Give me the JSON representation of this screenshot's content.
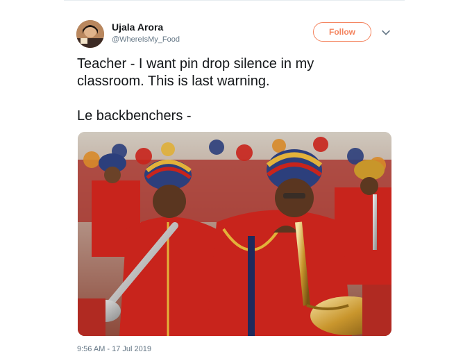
{
  "user": {
    "name": "Ujala Arora",
    "handle": "@WhereIsMy_Food"
  },
  "follow_label": "Follow",
  "tweet": {
    "text": "Teacher - I want pin drop silence in my\nclassroom. This is last warning.\n\nLe backbenchers -"
  },
  "timestamp": "9:56 AM - 17 Jul 2019",
  "colors": {
    "accent": "#f4845f",
    "secondary_text": "#657786",
    "uniform_red": "#c8241c"
  },
  "icons": {
    "menu": "chevron-down-icon"
  }
}
